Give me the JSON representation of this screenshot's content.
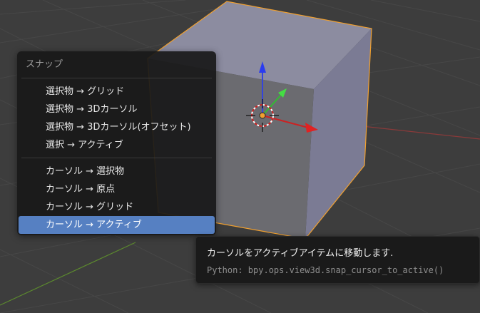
{
  "viewport": {
    "colors": {
      "background": "#3d3d3d",
      "grid": "#4a4a4a",
      "x_axis": "#8a3a3a",
      "y_axis": "#5c8a2e",
      "cube_top": "#8c8ca0",
      "cube_right": "#7b7b94",
      "cube_front": "#6e6e74",
      "selection_outline": "#f0a030"
    }
  },
  "snap_menu": {
    "title": "スナップ",
    "group1": [
      {
        "label": "選択物 → グリッド"
      },
      {
        "label": "選択物 → 3Dカーソル"
      },
      {
        "label": "選択物 → 3Dカーソル(オフセット)"
      },
      {
        "label": "選択 → アクティブ"
      }
    ],
    "group2": [
      {
        "label": "カーソル → 選択物"
      },
      {
        "label": "カーソル → 原点"
      },
      {
        "label": "カーソル → グリッド"
      },
      {
        "label": "カーソル → アクティブ",
        "active": true
      }
    ],
    "active_color": "#5680c2"
  },
  "tooltip": {
    "description": "カーソルをアクティブアイテムに移動します.",
    "python": "Python: bpy.ops.view3d.snap_cursor_to_active()"
  }
}
